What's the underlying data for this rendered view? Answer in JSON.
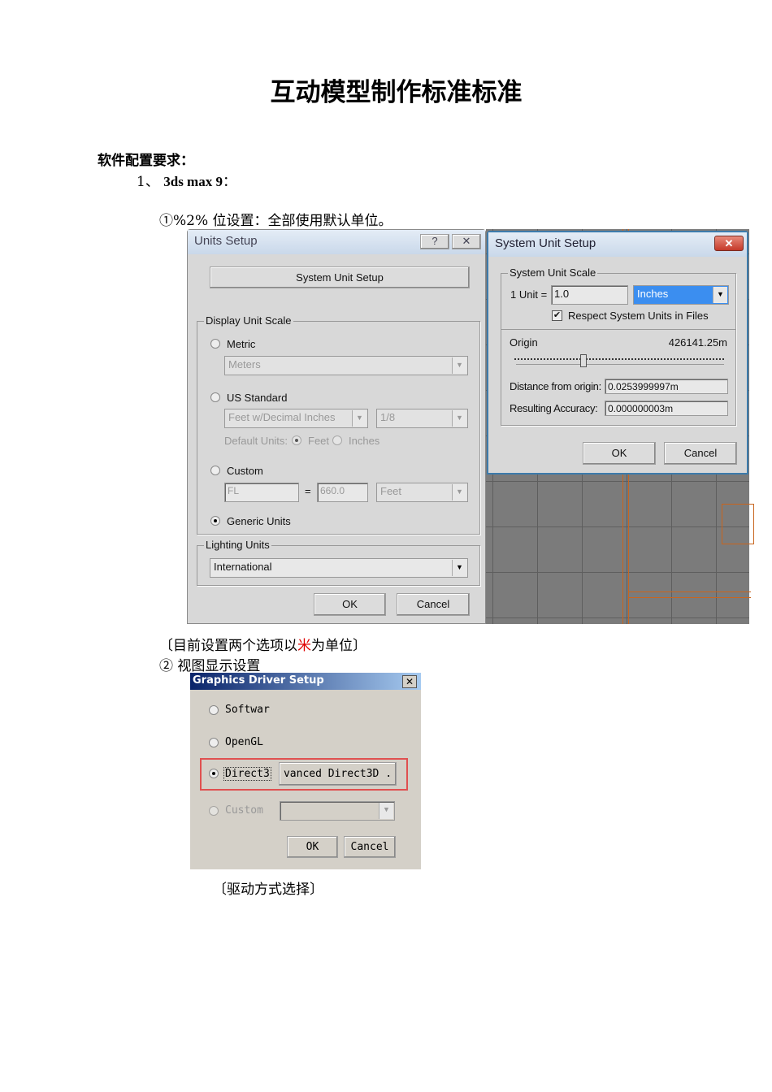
{
  "document": {
    "title": "互动模型制作标准标准",
    "section_heading": "软件配置要求：",
    "item_number": "1、",
    "item_title": "3ds max 9",
    "item_colon": "：",
    "step1": "①%2%  位设置：全部使用默认单位。",
    "note_before": "〔目前设置两个选项以",
    "note_highlight": "米",
    "note_after": "为单位〕",
    "highlight_color": "#e00000",
    "step2": "② 视图显示设置",
    "caption": "〔驱动方式选择〕"
  },
  "units_setup": {
    "title": "Units Setup",
    "help_icon": "?",
    "system_unit_setup_button": "System Unit Setup",
    "display_unit_scale": "Display Unit Scale",
    "metric_label": "Metric",
    "metric_value": "Meters",
    "us_standard_label": "US Standard",
    "us_unit_value": "Feet w/Decimal Inches",
    "us_fraction_value": "1/8",
    "default_units_label": "Default Units:",
    "default_feet": "Feet",
    "default_inches": "Inches",
    "custom_label": "Custom",
    "custom_name": "FL",
    "equals": "=",
    "custom_amount": "660.0",
    "custom_unit": "Feet",
    "generic_units_label": "Generic Units",
    "lighting_units": "Lighting Units",
    "lighting_value": "International",
    "ok": "OK",
    "cancel": "Cancel"
  },
  "system_unit_setup": {
    "title": "System Unit Setup",
    "scale_group": "System Unit Scale",
    "unit_label": "1 Unit =",
    "unit_value": "1.0",
    "unit_type": "Inches",
    "respect_label": "Respect System Units in Files",
    "respect_checked": true,
    "origin_label": "Origin",
    "origin_value": "426141.25m",
    "distance_label": "Distance from origin:",
    "distance_value": "0.0253999997m",
    "accuracy_label": "Resulting Accuracy:",
    "accuracy_value": "0.000000003m",
    "ok": "OK",
    "cancel": "Cancel"
  },
  "graphics_driver": {
    "title": "Graphics Driver Setup",
    "software": "Softwar",
    "opengl": "OpenGL",
    "direct3d": "Direct3",
    "advanced_button": "vanced Direct3D .",
    "custom": "Custom",
    "ok": "OK",
    "cancel": "Cancel"
  }
}
